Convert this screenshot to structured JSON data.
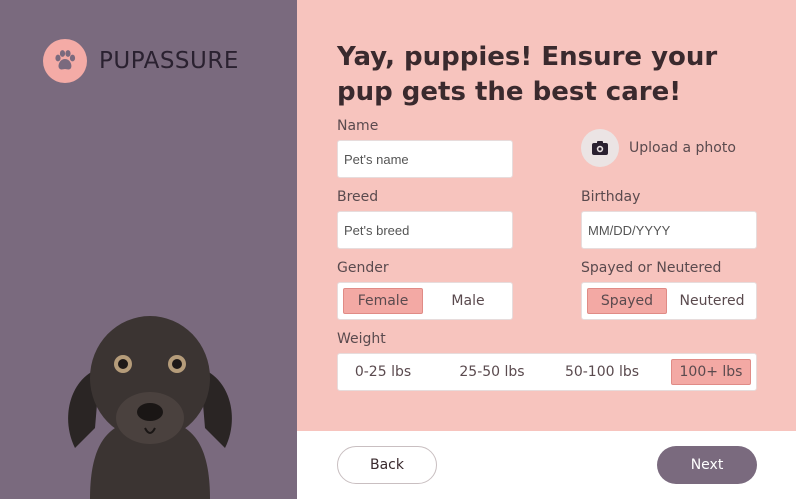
{
  "brand": {
    "name": "PUPASSURE",
    "icon": "paw-icon",
    "accent": "#f4aba6",
    "panel_color": "#7a6a7e"
  },
  "form": {
    "title": "Yay, puppies! Ensure your pup gets the best care!",
    "name": {
      "label": "Name",
      "placeholder": "Pet's name"
    },
    "upload": {
      "label": "Upload a photo",
      "icon": "camera-icon"
    },
    "breed": {
      "label": "Breed",
      "placeholder": "Pet's breed"
    },
    "birthday": {
      "label": "Birthday",
      "placeholder": "MM/DD/YYYY"
    },
    "gender": {
      "label": "Gender",
      "options": [
        "Female",
        "Male"
      ],
      "selected": "Female"
    },
    "spayed": {
      "label": "Spayed or Neutered",
      "options": [
        "Spayed",
        "Neutered"
      ],
      "selected": "Spayed"
    },
    "weight": {
      "label": "Weight",
      "options": [
        "0-25 lbs",
        "25-50 lbs",
        "50-100 lbs",
        "100+ lbs"
      ],
      "selected": "100+ lbs"
    }
  },
  "footer": {
    "back_label": "Back",
    "next_label": "Next"
  }
}
